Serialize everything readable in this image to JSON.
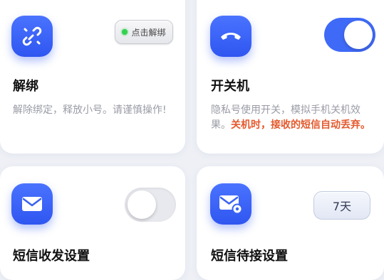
{
  "unbind_card": {
    "title": "解绑",
    "description": "解除绑定，释放小号。请谨慎操作!",
    "button_label": "点击解绑",
    "status_color": "#33d14f"
  },
  "power_card": {
    "title": "开关机",
    "description_normal": "隐私号使用开关，模拟手机关机效果。",
    "description_warning": "关机时，接收的短信自动丢弃。",
    "toggle_on": true
  },
  "sms_card": {
    "title": "短信收发设置",
    "toggle_on": false
  },
  "wait_card": {
    "title": "短信待接设置",
    "days_label": "7天"
  },
  "colors": {
    "accent": "#3f6af7",
    "warning": "#e45a2e",
    "icon_gradient_top": "#4a73ff",
    "icon_gradient_bottom": "#2f56f0"
  },
  "icons": {
    "unbind": "unlink-icon",
    "power": "phone-hangup-icon",
    "sms": "envelope-icon",
    "wait": "envelope-gear-icon"
  }
}
